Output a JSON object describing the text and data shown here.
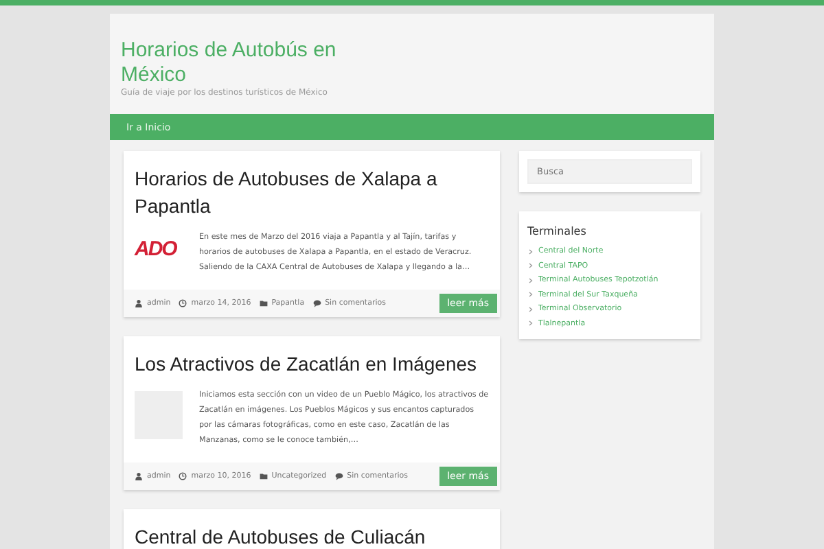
{
  "site": {
    "title": "Horarios de Autobús en México",
    "tagline": "Guía de viaje por los destinos turísticos de México"
  },
  "nav": [
    {
      "label": "Ir a Inicio"
    }
  ],
  "posts": [
    {
      "title": "Horarios de Autobuses de Xalapa a Papantla",
      "thumb": {
        "kind": "logo",
        "text": "ADO"
      },
      "excerpt": "En este mes de Marzo del 2016 viaja a Papantla y al Tajín, tarifas y horarios de autobuses de Xalapa a Papantla, en el estado de Veracruz. Saliendo de la CAXA Central de Autobuses de Xalapa y llegando a la…",
      "author": "admin",
      "date": "marzo 14, 2016",
      "category": "Papantla",
      "comments": "Sin comentarios",
      "more": "leer más"
    },
    {
      "title": "Los Atractivos de Zacatlán en Imágenes",
      "thumb": {
        "kind": "blank"
      },
      "excerpt": "Iniciamos esta sección con un video de un Pueblo Mágico, los atractivos de Zacatlán en imágenes. Los Pueblos Mágicos y sus encantos capturados por las cámaras fotográficas, como en este caso, Zacatlán de las Manzanas, como se le conoce también,…",
      "author": "admin",
      "date": "marzo 10, 2016",
      "category": "Uncategorized",
      "comments": "Sin comentarios",
      "more": "leer más"
    },
    {
      "title": "Central de Autobuses de Culiacán"
    }
  ],
  "sidebar": {
    "search": {
      "placeholder": "Busca"
    },
    "widget": {
      "title": "Terminales",
      "items": [
        "Central del Norte",
        "Central TAPO",
        "Terminal Autobuses Tepotzotlán",
        "Terminal del Sur Taxqueña",
        "Terminal Observatorio",
        "Tlalnepantla"
      ]
    }
  }
}
